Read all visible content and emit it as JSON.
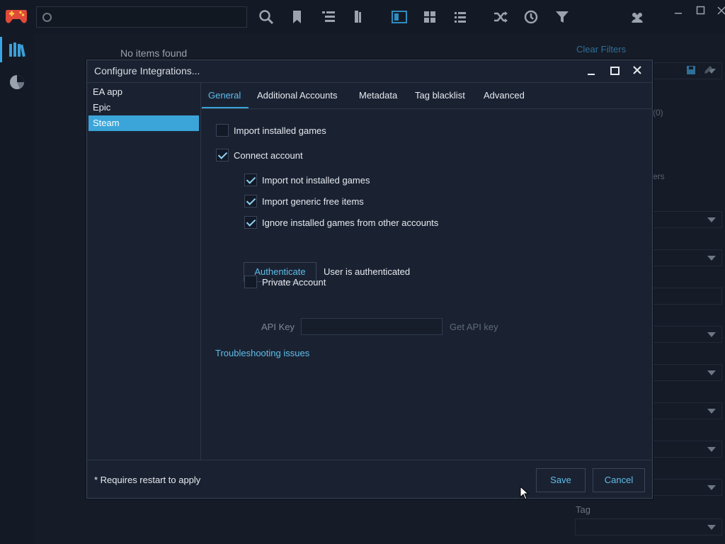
{
  "background": {
    "no_items_text": "No items found",
    "clear_filters": "Clear Filters",
    "tag_label": "Tag",
    "partial_text_count": "(0)",
    "partial_text_ers": "ers"
  },
  "dialog": {
    "title": "Configure Integrations...",
    "integrations": [
      {
        "label": "EA app"
      },
      {
        "label": "Epic"
      },
      {
        "label": "Steam"
      }
    ],
    "tabs": [
      {
        "label": "General"
      },
      {
        "label": "Additional Accounts"
      },
      {
        "label": "Metadata"
      },
      {
        "label": "Tag blacklist"
      },
      {
        "label": "Advanced"
      }
    ],
    "options": {
      "import_installed": {
        "label": "Import installed games",
        "checked": false
      },
      "connect_account": {
        "label": "Connect account",
        "checked": true
      },
      "import_not_installed": {
        "label": "Import not installed games",
        "checked": true
      },
      "import_free": {
        "label": "Import generic free items",
        "checked": true
      },
      "ignore_other": {
        "label": "Ignore installed games from other accounts",
        "checked": true
      },
      "private_account": {
        "label": "Private Account",
        "checked": false
      }
    },
    "authenticate_label": "Authenticate",
    "auth_status": "User is authenticated",
    "api_key_label": "API Key",
    "api_key_value": "",
    "get_api_key": "Get API key",
    "troubleshooting": "Troubleshooting issues",
    "restart_note": "* Requires restart to apply",
    "save_label": "Save",
    "cancel_label": "Cancel"
  },
  "colors": {
    "accent": "#3ba5d9",
    "link": "#5fbde9",
    "background": "#151b27",
    "dialog": "#1a2232"
  }
}
